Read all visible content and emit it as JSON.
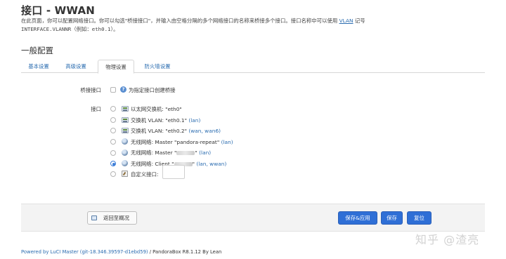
{
  "page": {
    "title": "接口 - WWAN",
    "description_part1": "在此页面，你可以配置网络接口。你可以勾选\"桥接接口\"，并输入由空格分隔的多个网络接口的名称来桥接多个接口。接口名称中可以使用",
    "description_vlan": "VLAN",
    "description_part2": "记号",
    "description_code": "INTERFACE.VLANNR",
    "description_part3": "（例如：",
    "description_example": "eth0.1",
    "description_part4": "）。"
  },
  "section": {
    "title": "一般配置"
  },
  "tabs": [
    {
      "label": "基本设置",
      "active": false
    },
    {
      "label": "高级设置",
      "active": false
    },
    {
      "label": "物理设置",
      "active": true
    },
    {
      "label": "防火墙设置",
      "active": false
    }
  ],
  "bridge": {
    "label": "桥接接口",
    "help_text": "为指定接口创建桥接"
  },
  "interface": {
    "label": "接口",
    "options": [
      {
        "icon": "ethernet-switch-icon",
        "text": "以太网交换机: \"eth0\"",
        "nets": "",
        "selected": false
      },
      {
        "icon": "ethernet-switch-icon",
        "text": "交换机 VLAN: \"eth0.1\"",
        "nets": "(lan)",
        "selected": false
      },
      {
        "icon": "ethernet-switch-icon",
        "text": "交换机 VLAN: \"eth0.2\"",
        "nets": "(wan, wan6)",
        "selected": false
      },
      {
        "icon": "wireless-icon",
        "text": "无线网络: Master \"pandora-repeat\"",
        "nets": "(lan)",
        "selected": false
      },
      {
        "icon": "wireless-icon",
        "text": "无线网络: Master \"",
        "text_end": "\"",
        "nets": "(lan)",
        "selected": false
      },
      {
        "icon": "wireless-icon",
        "text": "无线网络: Client \"",
        "text_end": "\"",
        "nets": "(lan, wwan)",
        "selected": true
      },
      {
        "icon": "custom-interface-icon",
        "text": "自定义接口:",
        "nets": "",
        "selected": false
      }
    ]
  },
  "actions": {
    "back_label": "返回至概况",
    "save_apply_label": "保存&应用",
    "save_label": "保存",
    "reset_label": "复位"
  },
  "footer": {
    "powered_link": "Powered by LuCI Master (git-18.346.39597-d1ebd59)",
    "powered_rest": " / PandoraBox R8.1.12 By Lean"
  },
  "watermark": "知乎 @渣亮",
  "colors": {
    "link": "#2a6cb0",
    "primary_button": "#2f6fd6"
  }
}
